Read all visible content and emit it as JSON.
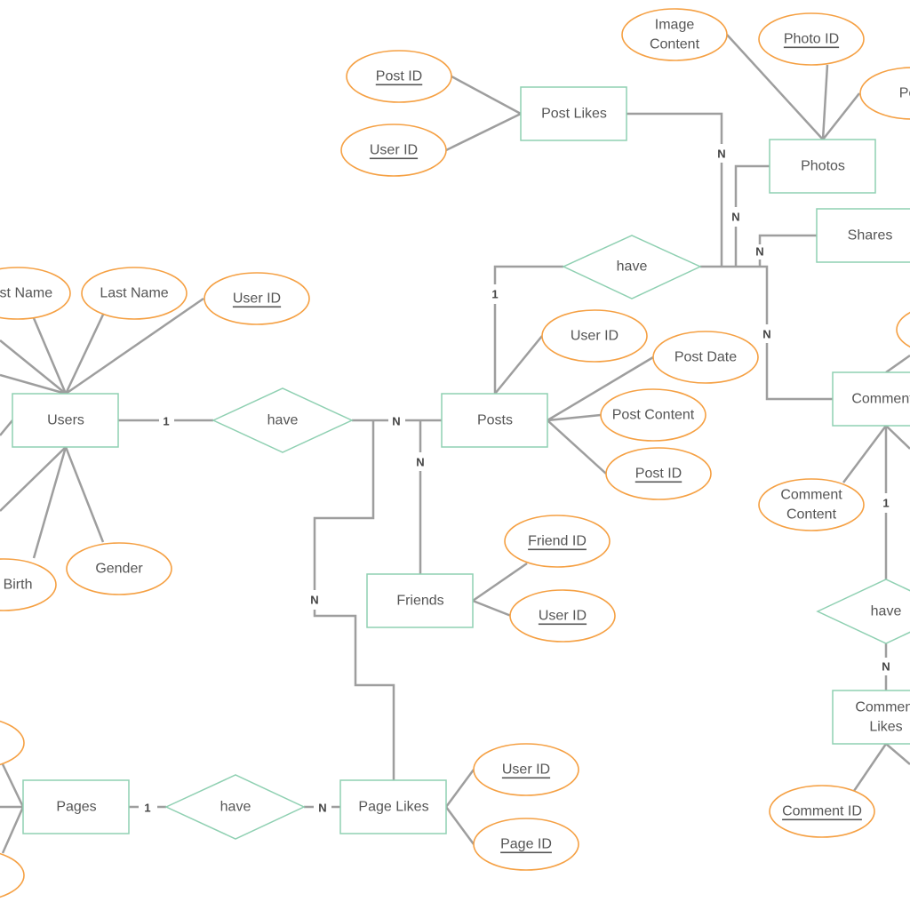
{
  "colors": {
    "entity_border": "#8fd0b2",
    "attribute_border": "#f5a043",
    "line": "#9e9e9e",
    "text": "#555555"
  },
  "entities": {
    "users": "Users",
    "posts": "Posts",
    "post_likes": "Post Likes",
    "photos": "Photos",
    "shares": "Shares",
    "comments": "Comments",
    "friends": "Friends",
    "pages": "Pages",
    "page_likes": "Page Likes",
    "comment_likes_1": "Comment",
    "comment_likes_2": "Likes"
  },
  "relationships": {
    "users_posts": "have",
    "posts_links": "have",
    "pages_pagelikes": "have",
    "comments_commentlikes": "have"
  },
  "attributes": {
    "users": {
      "first_name": "First Name",
      "last_name": "Last Name",
      "user_id": "User ID",
      "gender": "Gender",
      "dob": "Date of Birth"
    },
    "post_likes": {
      "post_id": "Post ID",
      "user_id": "User ID"
    },
    "photos": {
      "image_content_1": "Image",
      "image_content_2": "Content",
      "photo_id": "Photo ID",
      "post_id": "Post ID"
    },
    "posts": {
      "user_id": "User ID",
      "post_date": "Post Date",
      "post_content": "Post Content",
      "post_id": "Post ID"
    },
    "friends": {
      "friend_id": "Friend ID",
      "user_id": "User ID"
    },
    "comments": {
      "content_1": "Comment",
      "content_2": "Content"
    },
    "comment_likes": {
      "comment_id": "Comment ID"
    },
    "page_likes": {
      "user_id": "User ID",
      "page_id": "Page ID"
    }
  },
  "cardinality": {
    "one": "1",
    "many": "N"
  }
}
